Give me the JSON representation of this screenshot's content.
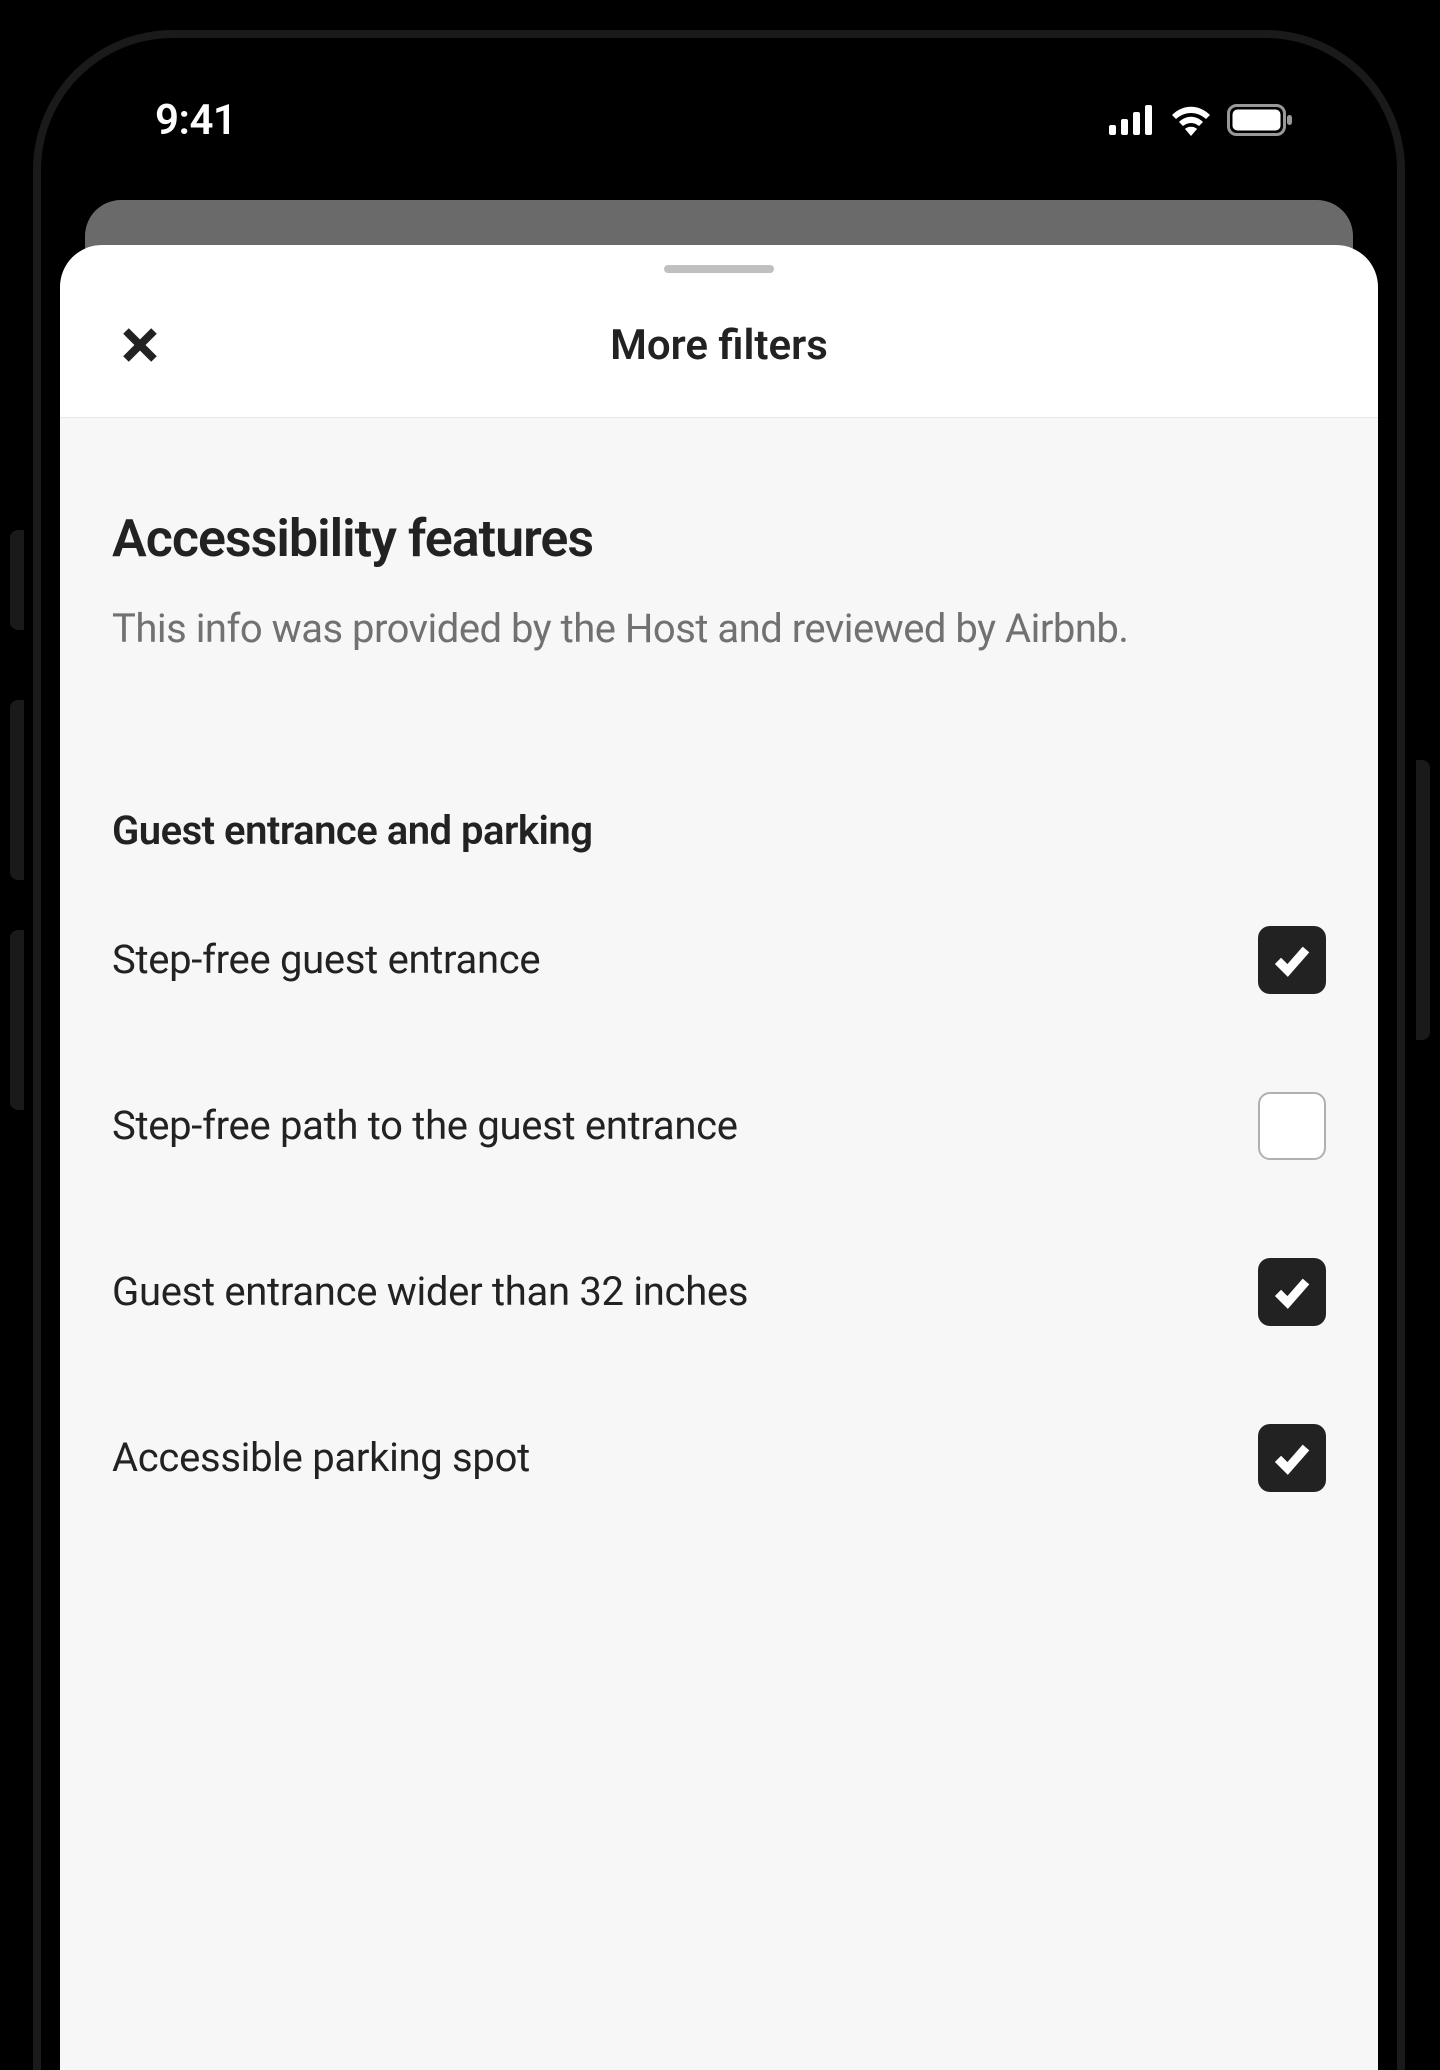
{
  "statusBar": {
    "time": "9:41"
  },
  "modal": {
    "title": "More filters"
  },
  "section": {
    "title": "Accessibility features",
    "subtitle": "This info was provided by the Host and reviewed by Airbnb."
  },
  "group": {
    "title": "Guest entrance and parking",
    "filters": [
      {
        "label": "Step-free guest entrance",
        "checked": true
      },
      {
        "label": "Step-free path to the guest entrance",
        "checked": false
      },
      {
        "label": "Guest entrance wider than 32 inches",
        "checked": true
      },
      {
        "label": "Accessible parking spot",
        "checked": true
      }
    ]
  }
}
